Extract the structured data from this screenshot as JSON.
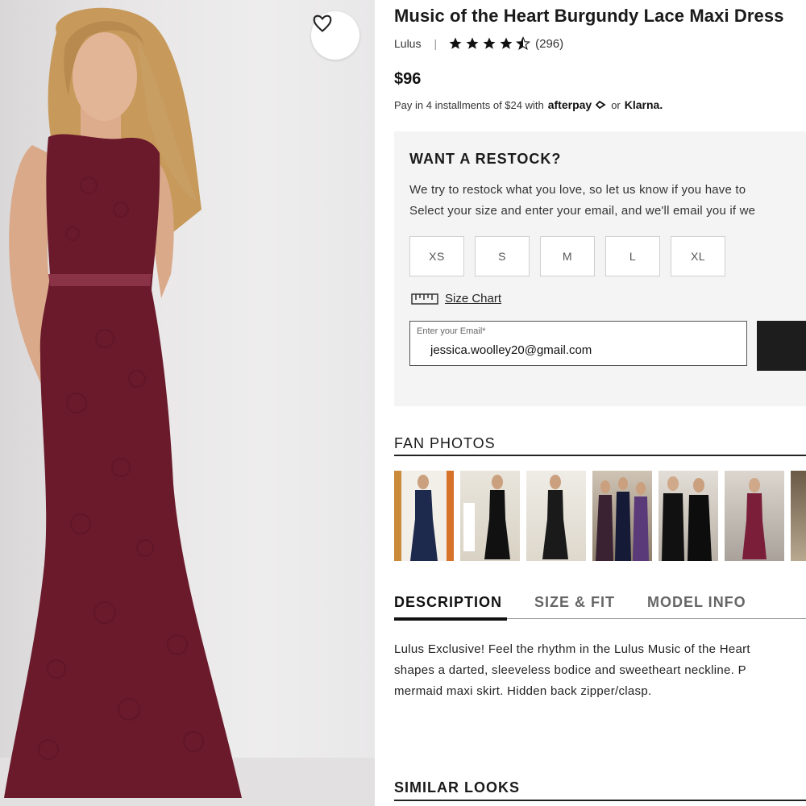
{
  "product": {
    "title": "Music of the Heart Burgundy Lace Maxi Dress",
    "brand": "Lulus",
    "rating": 4.5,
    "review_count": "(296)",
    "price": "$96",
    "installments_text": "Pay in 4 installments of $24 with",
    "afterpay_label": "afterpay",
    "or_text": "or",
    "klarna_label": "Klarna."
  },
  "restock": {
    "heading": "WANT A RESTOCK?",
    "line1": "We try to restock what you love, so let us know if you have to",
    "line2": "Select your size and enter your email, and we'll email you if we",
    "sizes": [
      "XS",
      "S",
      "M",
      "L",
      "XL"
    ],
    "size_chart_label": "Size Chart",
    "email_label": "Enter your Email*",
    "email_value": "jessica.woolley20@gmail.com"
  },
  "fan_photos": {
    "heading": "FAN PHOTOS"
  },
  "tabs": {
    "items": [
      "DESCRIPTION",
      "SIZE & FIT",
      "MODEL INFO"
    ],
    "active": "DESCRIPTION"
  },
  "description": {
    "line1": "Lulus Exclusive! Feel the rhythm in the Lulus Music of the Heart",
    "line2": "shapes a darted, sleeveless bodice and sweetheart neckline. P",
    "line3": "mermaid maxi skirt. Hidden back zipper/clasp."
  },
  "similar_looks": {
    "heading": "SIMILAR LOOKS"
  },
  "colors": {
    "burgundy": "#6b1a2c",
    "accent_dark": "#1d1d1d",
    "panel_bg": "#f4f4f4"
  },
  "icons": [
    "heart-icon",
    "star-icon",
    "ruler-icon"
  ]
}
